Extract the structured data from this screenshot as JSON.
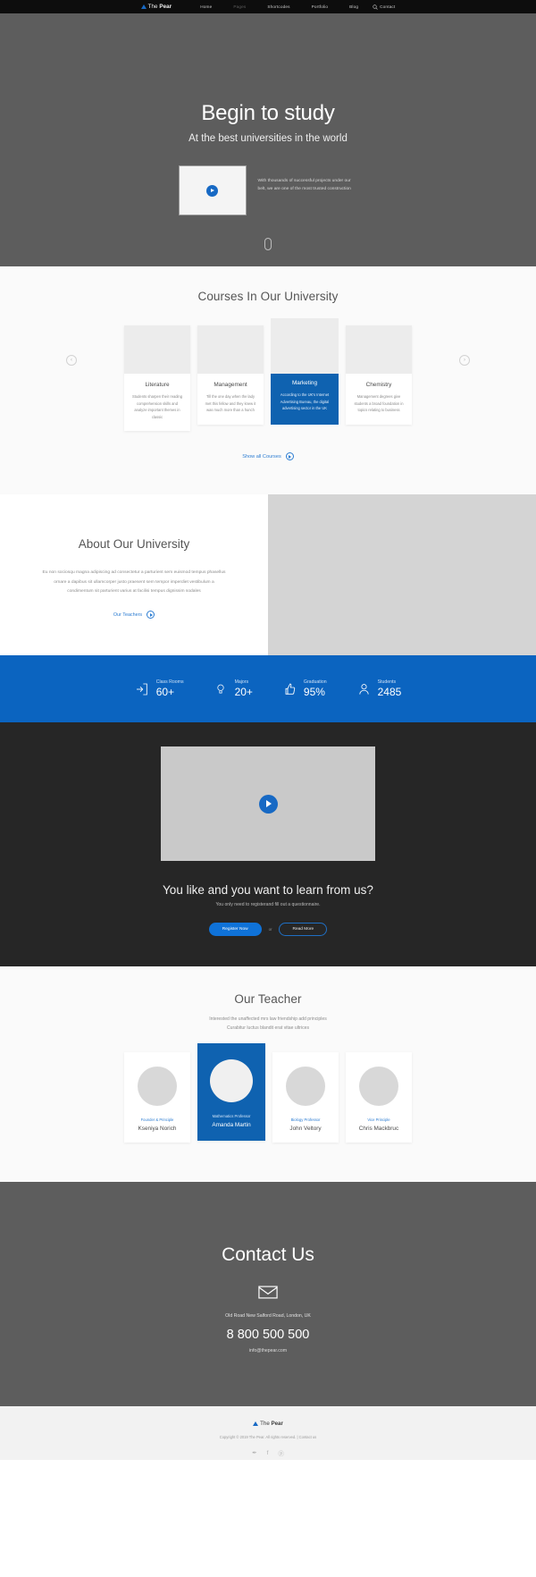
{
  "nav": {
    "logo": {
      "prefix": "The ",
      "bold": "Pear",
      "icon": "triangle-logo-icon"
    },
    "links": [
      {
        "label": "Home",
        "active": true
      },
      {
        "label": "Pages",
        "active": false
      },
      {
        "label": "Shortcodes",
        "active": false
      },
      {
        "label": "Portfolio",
        "active": false
      },
      {
        "label": "Blog",
        "active": false
      },
      {
        "label": "Contact",
        "active": false
      }
    ],
    "search_icon": "search-icon"
  },
  "hero": {
    "title": "Begin to study",
    "subtitle": "At the best universities in the world",
    "description": "With thousands of successful projects under our belt, we are one of the most trusted construction",
    "play_icon": "play-icon",
    "scroll_icon": "mouse-scroll-icon"
  },
  "courses": {
    "title": "Courses In Our University",
    "prev_label": "‹",
    "next_label": "›",
    "show_all_label": "Show all Courses",
    "items": [
      {
        "title": "Literature",
        "text": "Students sharpen their reading comprehension skills and analyze important themes in classic",
        "featured": false
      },
      {
        "title": "Management",
        "text": "Till the one day when the lady met this fellow and they knew it was much more than a hunch",
        "featured": false
      },
      {
        "title": "Marketing",
        "text": "According to the UK's Internet Advertising Bureau, the digital advertising sector in the UK",
        "featured": true
      },
      {
        "title": "Chemistry",
        "text": "Management degrees give students a broad foundation in topics relating to business",
        "featured": false
      }
    ]
  },
  "about": {
    "title": "About Our University",
    "text": "Eu non sociosqu magna adipiscing ad consectetur a parturient sem euismod tempus phasellus ornare a dapibus sit ullamcorper justo praesent sem tempor imperdiet vestibulum a condimentum sit parturient varius at facilisi tempus dignissim sodales",
    "link_label": "Our Teachers"
  },
  "stats": [
    {
      "label": "Class Rooms",
      "value": "60+",
      "icon": "door-exit-icon"
    },
    {
      "label": "Majors",
      "value": "20+",
      "icon": "lightbulb-icon"
    },
    {
      "label": "Graduation",
      "value": "95%",
      "icon": "thumbs-up-icon"
    },
    {
      "label": "Students",
      "value": "2485",
      "icon": "user-icon"
    }
  ],
  "cta": {
    "title": "You like and you want to learn from us?",
    "subtitle": "You only need to registerand fill out a questionnaire.",
    "primary_button": "Register Now",
    "separator": "or",
    "secondary_button": "Read More",
    "play_icon": "play-icon"
  },
  "teachers": {
    "title": "Our Teacher",
    "subtitle_line1": "Interested the unaffected mrs law friendship add principles",
    "subtitle_line2": "Curabitur luctus blandit erat vitae ultrices",
    "items": [
      {
        "role": "Founder & Principle",
        "name": "Kseniya Norich",
        "featured": false
      },
      {
        "role": "Mathematics Professor",
        "name": "Amanda Martin",
        "featured": true
      },
      {
        "role": "Biology Professor",
        "name": "John Veltory",
        "featured": false
      },
      {
        "role": "Vice Principle",
        "name": "Chris Mackbruc",
        "featured": false
      }
    ]
  },
  "contact": {
    "title": "Contact Us",
    "mail_icon": "envelope-icon",
    "address": "Old Road New Salford Road, London, UK",
    "phone": "8 800 500 500",
    "email": "info@thepear.com"
  },
  "footer": {
    "logo": {
      "prefix": "The ",
      "bold": "Pear",
      "icon": "triangle-logo-icon"
    },
    "copyright": "Copyright © 2019 The Pear. All rights reserved.  |  Contact us",
    "social": [
      {
        "icon": "twitter-icon",
        "glyph": "✒"
      },
      {
        "icon": "facebook-icon",
        "glyph": "f"
      },
      {
        "icon": "pinterest-icon",
        "glyph": "ⓟ"
      }
    ]
  },
  "colors": {
    "accent": "#0f62b0",
    "accent_bright": "#0f72d8",
    "hero_bg": "#5d5d5d",
    "dark_bg": "#262626",
    "light_bg": "#fafafa"
  }
}
